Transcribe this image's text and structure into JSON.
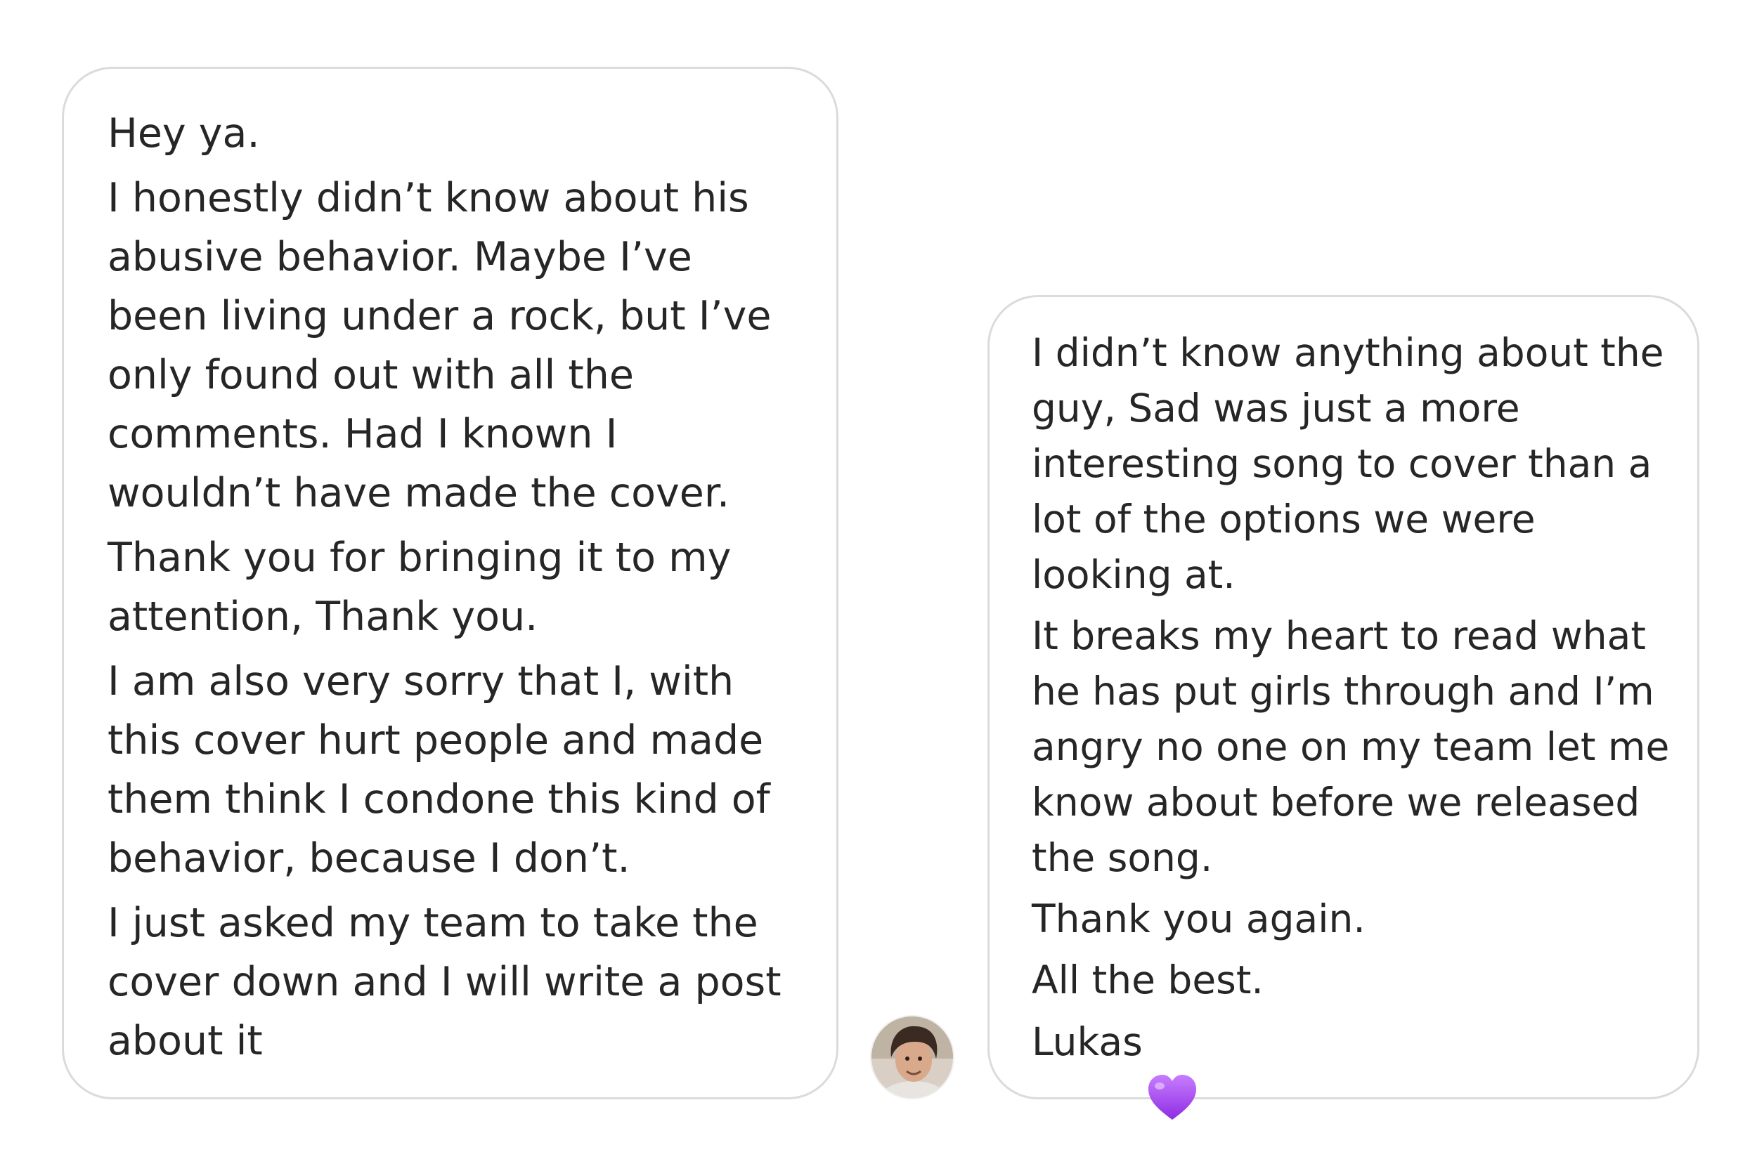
{
  "thread": {
    "message_left": {
      "paragraphs": [
        "Hey ya.",
        "I honestly didn’t know about his\nabusive behavior. Maybe I’ve\nbeen living under a rock, but I’ve\nonly found out with all the\ncomments. Had I known I\nwouldn’t have made the cover.",
        "Thank you for bringing it to my\nattention, Thank you.",
        "I am also very sorry that I, with\nthis cover hurt people and made\nthem think I condone this kind of\nbehavior, because I don’t.",
        "I just asked my team to take the\ncover down and I will write a post\nabout it"
      ]
    },
    "message_right": {
      "paragraphs": [
        "I didn’t know anything about the\nguy, Sad was just a more\ninteresting song to cover than a\nlot of the options we were\nlooking at.",
        "It breaks my heart to read what\nhe has put girls through and I’m\nangry no one on my team let me\nknow about before we released\nthe song.",
        "Thank you again.",
        "All the best."
      ],
      "signature": "Lukas",
      "signature_icon": "purple-heart-icon"
    },
    "avatar_icon": "avatar",
    "colors": {
      "bubble_border": "#dbdbdb",
      "text": "#262626",
      "heart": "#a855f7"
    }
  }
}
